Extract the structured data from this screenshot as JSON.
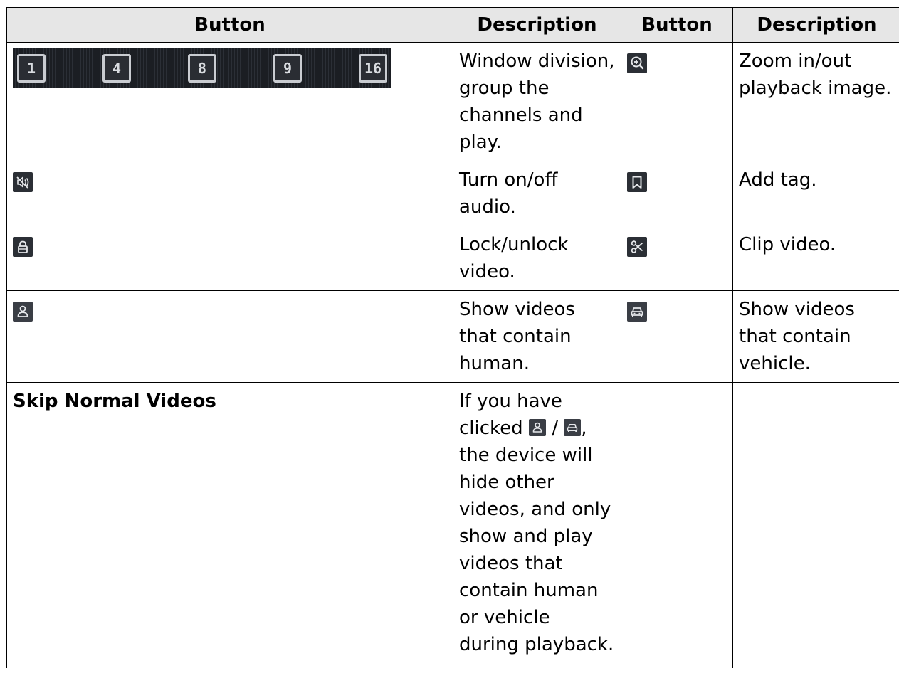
{
  "table": {
    "headers": [
      "Button",
      "Description",
      "Button",
      "Description"
    ],
    "window_division_buttons": [
      "1",
      "4",
      "8",
      "9",
      "16"
    ],
    "rows": [
      {
        "left_desc": "Window division, group the channels and play.",
        "right_icon": "zoom-in-icon",
        "right_desc": "Zoom in/out playback image."
      },
      {
        "left_icon": "audio-mute-icon",
        "left_desc": "Turn on/off audio.",
        "right_icon": "bookmark-tag-icon",
        "right_desc": "Add tag."
      },
      {
        "left_icon": "lock-icon",
        "left_desc": "Lock/unlock video.",
        "right_icon": "scissors-icon",
        "right_desc": "Clip video."
      },
      {
        "left_icon": "human-icon",
        "left_desc": "Show videos that contain human.",
        "right_icon": "vehicle-icon",
        "right_desc": "Show videos that contain vehicle."
      },
      {
        "left_label": "Skip Normal Videos",
        "desc_part1": "If you have clicked",
        "desc_sep": "/",
        "desc_part2": ", the device will hide other videos, and only show and play videos that contain human or vehicle during playback."
      }
    ]
  },
  "colors": {
    "icon_bg": "#2b2f35",
    "icon_fg": "#e6e8eb",
    "header_bg": "#e6e6e6"
  }
}
